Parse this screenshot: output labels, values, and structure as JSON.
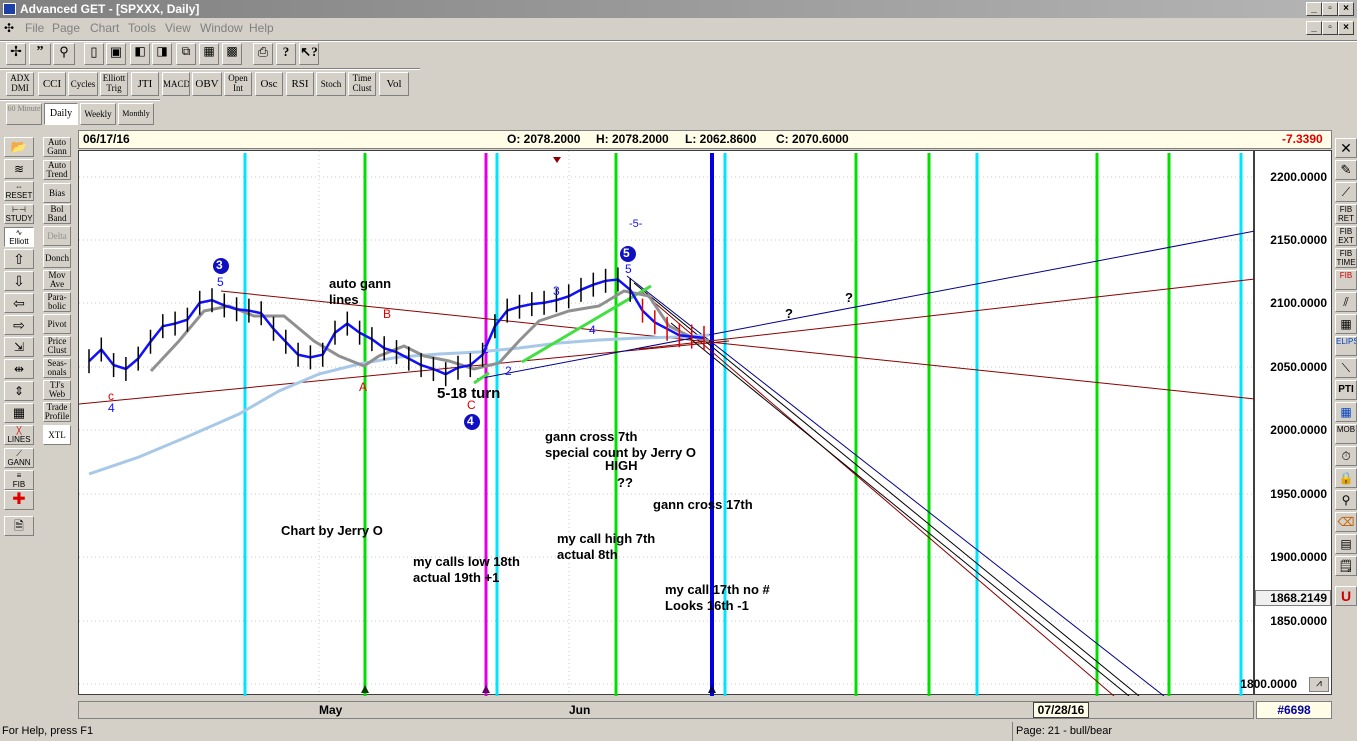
{
  "window": {
    "title": "Advanced GET - [SPXXX, Daily]"
  },
  "menu": [
    "File",
    "Page",
    "Chart",
    "Tools",
    "View",
    "Window",
    "Help"
  ],
  "indicator_toolbar": [
    "ADX DMI",
    "CCI",
    "Cycles",
    "Elliott Trig",
    "JTI",
    "MACD",
    "OBV",
    "Open Int",
    "Osc",
    "RSI",
    "Stoch",
    "Time Clust",
    "Vol"
  ],
  "period_toolbar": [
    "60 Minute",
    "Daily",
    "Weekly",
    "Monthly"
  ],
  "left_tools": [
    "Auto Gann",
    "Auto Trend",
    "Bias",
    "Bol Band",
    "Delta",
    "Donch",
    "Mov Ave",
    "Para-bolic",
    "Pivot",
    "Price Clust",
    "Seas-onals",
    "TJ's Web",
    "Trade Profile",
    "XTL"
  ],
  "left_icons": [
    "RESET",
    "STUDY",
    "Elliott",
    "LINES",
    "GANN",
    "FIB"
  ],
  "right_icons": [
    "FIB RET",
    "FIB EXT",
    "FIB TIME",
    "FIB",
    "ELIPS",
    "PTI",
    "MOB",
    "U"
  ],
  "info": {
    "date": "06/17/16",
    "open": "O: 2078.2000",
    "high": "H: 2078.2000",
    "low": "L: 2062.8600",
    "close": "C: 2070.6000",
    "change": "-7.3390"
  },
  "y_axis": {
    "ticks": [
      "2200.0000",
      "2150.0000",
      "2100.0000",
      "2050.0000",
      "2000.0000",
      "1950.0000",
      "1900.0000",
      "1850.0000",
      "1800.0000"
    ],
    "cursor_value": "1868.2149"
  },
  "x_axis": {
    "labels": [
      "May",
      "Jun"
    ],
    "cursor_date": "07/28/16",
    "bar_number": "#6698"
  },
  "annotations": {
    "auto_gann": "auto gann",
    "lines": "lines",
    "turn": "5-18 turn",
    "gann_cross_7th": "gann cross 7th",
    "special_count": "special count by Jerry O",
    "high": "HIGH",
    "qq": "??",
    "gann_cross_17th": "gann cross 17th",
    "chart_by": "Chart by Jerry O",
    "calls_low": "my calls low 18th",
    "actual_19th": "actual 19th +1",
    "call_high": "my call high 7th",
    "actual_8th": "actual 8th",
    "call_17th": "my call 17th no #",
    "looks_16th": "Looks 16th -1",
    "q1": "?",
    "q2": "?",
    "wave5_top": "-5-"
  },
  "wave_labels": {
    "circle3": "3",
    "circle4": "4",
    "circle5": "5",
    "w5a": "5",
    "w5b": "5",
    "w3": "3",
    "w4": "4",
    "w1": "1",
    "w2": "2",
    "c_lower": "c",
    "four_low": "4",
    "A": "A",
    "B": "B",
    "C": "C"
  },
  "status": {
    "help": "For Help, press F1",
    "page": "Page: 21 - bull/bear"
  },
  "colors": {
    "cyan_line": "#00e5ff",
    "green_line": "#00e000",
    "magenta_line": "#e000e0",
    "blue_line": "#0000e0",
    "price": "#1010ff"
  },
  "chart_data": {
    "type": "line",
    "title": "",
    "ylim": [
      1795,
      2215
    ],
    "price_path": [
      2053,
      2062,
      2050,
      2047,
      2055,
      2068,
      2080,
      2082,
      2085,
      2098,
      2100,
      2096,
      2093,
      2092,
      2090,
      2078,
      2068,
      2058,
      2056,
      2058,
      2075,
      2082,
      2075,
      2070,
      2063,
      2060,
      2055,
      2050,
      2047,
      2043,
      2048,
      2050,
      2058,
      2080,
      2092,
      2095,
      2097,
      2098,
      2100,
      2103,
      2108,
      2112,
      2115,
      2116,
      2108,
      2092,
      2083,
      2078,
      2073,
      2072,
      2071
    ]
  }
}
